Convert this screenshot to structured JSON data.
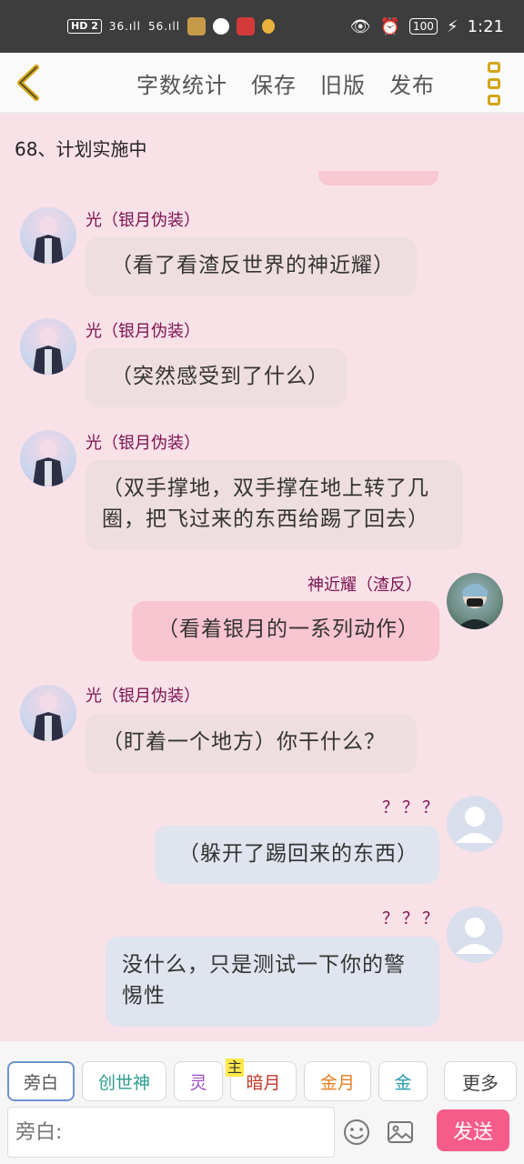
{
  "status_bar": {
    "hd_label": "HD",
    "sim_label": "2",
    "signal_1": "36.ıll",
    "signal_2": "56.ıll",
    "battery": "100",
    "time": "1:21"
  },
  "topbar": {
    "actions": [
      "字数统计",
      "保存",
      "旧版",
      "发布"
    ]
  },
  "chapter_title": "68、计划实施中",
  "messages": [
    {
      "speaker": "光（银月伪装）",
      "text": "（看了看渣反世界的神近耀）",
      "side": "left"
    },
    {
      "speaker": "光（银月伪装）",
      "text": "（突然感受到了什么）",
      "side": "left"
    },
    {
      "speaker": "光（银月伪装）",
      "text": "（双手撑地，双手撑在地上转了几圈，把飞过来的东西给踢了回去）",
      "side": "left"
    },
    {
      "speaker": "神近耀（渣反）",
      "text": "（看着银月的一系列动作）",
      "side": "right"
    },
    {
      "speaker": "光（银月伪装）",
      "text": "（盯着一个地方）你干什么？",
      "side": "left"
    },
    {
      "speaker": "？？？",
      "text": "（躲开了踢回来的东西）",
      "side": "right"
    },
    {
      "speaker": "？？？",
      "text": "没什么，只是测试一下你的警惕性",
      "side": "right"
    }
  ],
  "composer": {
    "roles": [
      "旁白",
      "创世神",
      "灵",
      "暗月",
      "金月",
      "金"
    ],
    "host_badge": "主",
    "more_label": "更多",
    "input_placeholder": "旁白:",
    "send_label": "发送"
  },
  "colors": {
    "accent_gold": "#d3a514",
    "send_pink": "#f55c8a",
    "speaker_color": "#7a1350",
    "page_bg": "#f9e1e8"
  }
}
